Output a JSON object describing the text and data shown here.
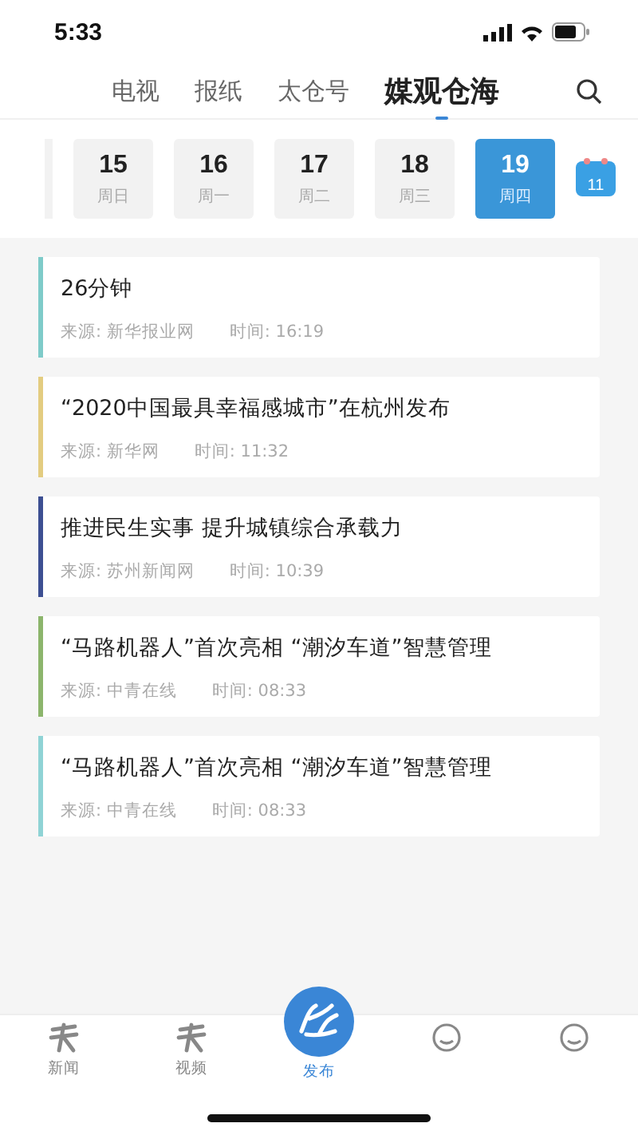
{
  "status_bar": {
    "time": "5:33"
  },
  "tabs": [
    {
      "label": "电视",
      "selected": false
    },
    {
      "label": "报纸",
      "selected": false
    },
    {
      "label": "太仓号",
      "selected": false
    },
    {
      "label": "媒观仓海",
      "selected": true
    }
  ],
  "dates": [
    {
      "day": "15",
      "weekday": "周日",
      "selected": false
    },
    {
      "day": "16",
      "weekday": "周一",
      "selected": false
    },
    {
      "day": "17",
      "weekday": "周二",
      "selected": false
    },
    {
      "day": "18",
      "weekday": "周三",
      "selected": false
    },
    {
      "day": "19",
      "weekday": "周四",
      "selected": true
    }
  ],
  "calendar_day": "11",
  "news": [
    {
      "title": "26分钟",
      "source": "来源: 新华报业网",
      "time": "时间: 16:19",
      "color": "#7ecbc9"
    },
    {
      "title": "“2020中国最具幸福感城市”在杭州发布",
      "source": "来源: 新华网",
      "time": "时间: 11:32",
      "color": "#e3cc80"
    },
    {
      "title": "推进民生实事 提升城镇综合承载力",
      "source": "来源: 苏州新闻网",
      "time": "时间: 10:39",
      "color": "#3d4f92"
    },
    {
      "title": "“马路机器人”首次亮相 “潮汐车道”智慧管理",
      "source": "来源: 中青在线",
      "time": "时间: 08:33",
      "color": "#8cb56c"
    },
    {
      "title": "“马路机器人”首次亮相 “潮汐车道”智慧管理",
      "source": "来源: 中青在线",
      "time": "时间: 08:33",
      "color": "#8fd3d5"
    }
  ],
  "bottom_nav": [
    {
      "kind": "plain",
      "label": "新闻",
      "selected": false
    },
    {
      "kind": "plain",
      "label": "视频",
      "selected": false
    },
    {
      "kind": "center",
      "label": "发布",
      "selected": true
    },
    {
      "kind": "hidden",
      "selected": false
    },
    {
      "kind": "hidden",
      "selected": false
    }
  ]
}
